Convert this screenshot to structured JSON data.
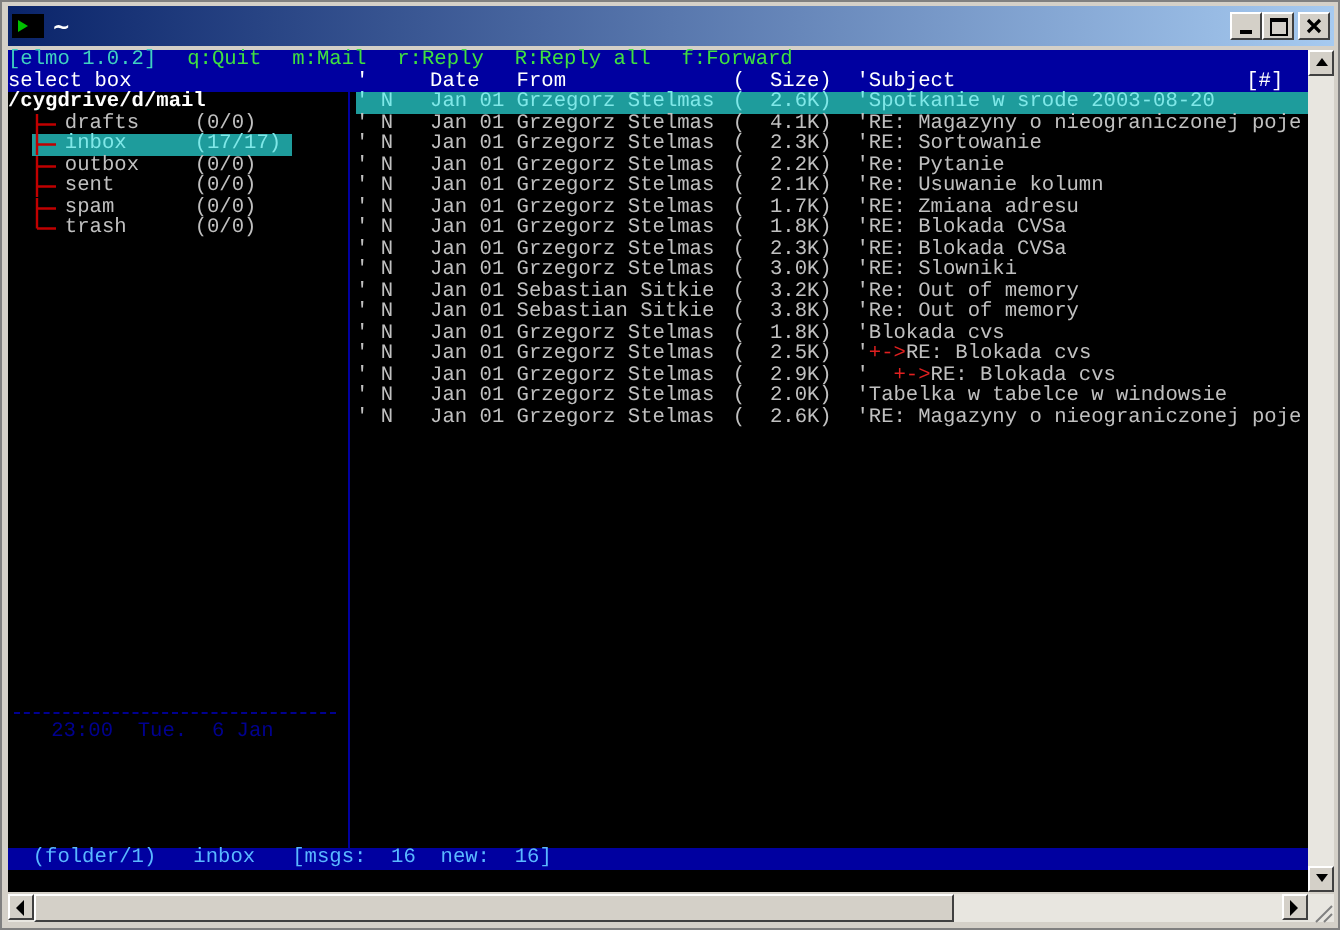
{
  "window": {
    "title": "~"
  },
  "menu_line": {
    "app": "[elmo 1.0.2]",
    "shortcuts": [
      "q:Quit",
      "m:Mail",
      "r:Reply",
      "R:Reply all",
      "f:Forward"
    ]
  },
  "folder_pane": {
    "title": "select box",
    "path": "/cygdrive/d/mail",
    "folders": [
      {
        "name": "drafts",
        "count": "(0/0)",
        "selected": false
      },
      {
        "name": "inbox",
        "count": "(17/17)",
        "selected": true
      },
      {
        "name": "outbox",
        "count": "(0/0)",
        "selected": false
      },
      {
        "name": "sent",
        "count": "(0/0)",
        "selected": false
      },
      {
        "name": "spam",
        "count": "(0/0)",
        "selected": false
      },
      {
        "name": "trash",
        "count": "(0/0)",
        "selected": false
      }
    ],
    "clock": "23:00  Tue.  6 Jan"
  },
  "message_list": {
    "columns": [
      "'",
      "Date",
      "From",
      "(  Size)",
      "'Subject",
      "[#]"
    ],
    "messages": [
      {
        "flag": "'",
        "status": "N",
        "date": "Jan 01",
        "from": "Grzegorz Stelmas",
        "size": "(  2.6K)",
        "subject_mark": "'",
        "subject": "Spotkanie w srode 2003-08-20",
        "selected": true
      },
      {
        "flag": "'",
        "status": "N",
        "date": "Jan 01",
        "from": "Grzegorz Stelmas",
        "size": "(  4.1K)",
        "subject_mark": "'",
        "subject": "RE: Magazyny o nieograniczonej poje",
        "selected": false
      },
      {
        "flag": "'",
        "status": "N",
        "date": "Jan 01",
        "from": "Grzegorz Stelmas",
        "size": "(  2.3K)",
        "subject_mark": "'",
        "subject": "RE: Sortowanie",
        "selected": false
      },
      {
        "flag": "'",
        "status": "N",
        "date": "Jan 01",
        "from": "Grzegorz Stelmas",
        "size": "(  2.2K)",
        "subject_mark": "'",
        "subject": "Re: Pytanie",
        "selected": false
      },
      {
        "flag": "'",
        "status": "N",
        "date": "Jan 01",
        "from": "Grzegorz Stelmas",
        "size": "(  2.1K)",
        "subject_mark": "'",
        "subject": "Re: Usuwanie kolumn",
        "selected": false
      },
      {
        "flag": "'",
        "status": "N",
        "date": "Jan 01",
        "from": "Grzegorz Stelmas",
        "size": "(  1.7K)",
        "subject_mark": "'",
        "subject": "RE: Zmiana adresu",
        "selected": false
      },
      {
        "flag": "'",
        "status": "N",
        "date": "Jan 01",
        "from": "Grzegorz Stelmas",
        "size": "(  1.8K)",
        "subject_mark": "'",
        "subject": "RE: Blokada CVSa",
        "selected": false
      },
      {
        "flag": "'",
        "status": "N",
        "date": "Jan 01",
        "from": "Grzegorz Stelmas",
        "size": "(  2.3K)",
        "subject_mark": "'",
        "subject": "RE: Blokada CVSa",
        "selected": false
      },
      {
        "flag": "'",
        "status": "N",
        "date": "Jan 01",
        "from": "Grzegorz Stelmas",
        "size": "(  3.0K)",
        "subject_mark": "'",
        "subject": "RE: Slowniki",
        "selected": false
      },
      {
        "flag": "'",
        "status": "N",
        "date": "Jan 01",
        "from": "Sebastian Sitkie",
        "size": "(  3.2K)",
        "subject_mark": "'",
        "subject": "Re: Out of memory",
        "selected": false
      },
      {
        "flag": "'",
        "status": "N",
        "date": "Jan 01",
        "from": "Sebastian Sitkie",
        "size": "(  3.8K)",
        "subject_mark": "'",
        "subject": "Re: Out of memory",
        "selected": false
      },
      {
        "flag": "'",
        "status": "N",
        "date": "Jan 01",
        "from": "Grzegorz Stelmas",
        "size": "(  1.8K)",
        "subject_mark": "'",
        "subject": "Blokada cvs",
        "selected": false,
        "children": [
          {
            "flag": "'",
            "status": "N",
            "date": "Jan 01",
            "from": "Grzegorz Stelmas",
            "size": "(  2.5K)",
            "subject_mark": "'",
            "thread_marker": "+->",
            "subject": "RE: Blokada cvs",
            "selected": false,
            "children": [
              {
                "flag": "'",
                "status": "N",
                "date": "Jan 01",
                "from": "Grzegorz Stelmas",
                "size": "(  2.9K)",
                "subject_mark": "'",
                "thread_marker": "+->",
                "subject": "RE: Blokada cvs",
                "selected": false
              }
            ]
          }
        ]
      },
      {
        "flag": "'",
        "status": "N",
        "date": "Jan 01",
        "from": "Grzegorz Stelmas",
        "size": "(  2.0K)",
        "subject_mark": "'",
        "subject": "Tabelka w tabelce w windowsie",
        "selected": false
      },
      {
        "flag": "'",
        "status": "N",
        "date": "Jan 01",
        "from": "Grzegorz Stelmas",
        "size": "(  2.6K)",
        "subject_mark": "'",
        "subject": "RE: Magazyny o nieograniczonej poje",
        "selected": false
      }
    ]
  },
  "status_bar": [
    "(folder/1)",
    "inbox",
    "[msgs:  16  new:  16]"
  ]
}
